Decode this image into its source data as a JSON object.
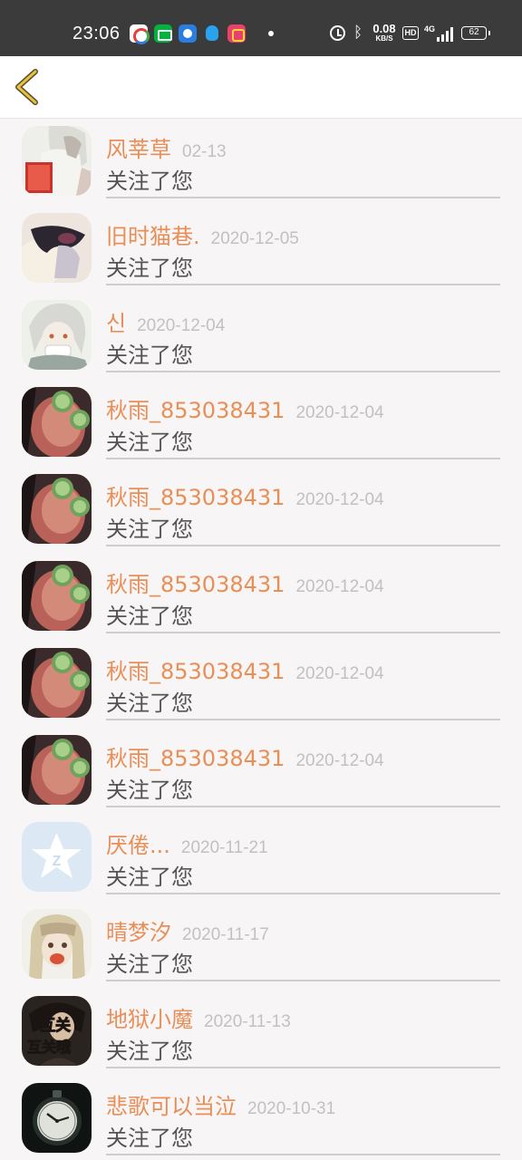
{
  "status_bar": {
    "time": "23:06",
    "net_speed_value": "0.08",
    "net_speed_unit": "KB/S",
    "hd_label": "HD",
    "signal_label": "4G",
    "battery_level": "62",
    "icons": [
      "chrome-like-app-icon",
      "iqiyi-icon",
      "browser-app-icon",
      "qq-icon",
      "kuaishou-icon",
      "alarm-icon",
      "bluetooth-icon"
    ]
  },
  "header": {
    "back_icon": "chevron-left-icon"
  },
  "colors": {
    "name": "#e98e57",
    "date": "#c2c0c1",
    "text": "#545454",
    "back_icon": "#e0b937"
  },
  "follow_list": [
    {
      "name": "风莘草",
      "date": "02-13",
      "action": "关注了您",
      "avatar": "anime-reading"
    },
    {
      "name": "旧时猫巷.",
      "date": "2020-12-05",
      "action": "关注了您",
      "avatar": "anime-blur"
    },
    {
      "name": "신",
      "date": "2020-12-04",
      "action": "关注了您",
      "avatar": "anime-silver"
    },
    {
      "name": "秋雨_853038431",
      "date": "2020-12-04",
      "action": "关注了您",
      "avatar": "photo-face"
    },
    {
      "name": "秋雨_853038431",
      "date": "2020-12-04",
      "action": "关注了您",
      "avatar": "photo-face"
    },
    {
      "name": "秋雨_853038431",
      "date": "2020-12-04",
      "action": "关注了您",
      "avatar": "photo-face"
    },
    {
      "name": "秋雨_853038431",
      "date": "2020-12-04",
      "action": "关注了您",
      "avatar": "photo-face"
    },
    {
      "name": "秋雨_853038431",
      "date": "2020-12-04",
      "action": "关注了您",
      "avatar": "photo-face"
    },
    {
      "name": "厌倦...",
      "date": "2020-11-21",
      "action": "关注了您",
      "avatar": "qzone-default"
    },
    {
      "name": "晴梦汐",
      "date": "2020-11-17",
      "action": "关注了您",
      "avatar": "anime-girl"
    },
    {
      "name": "地狱小魔",
      "date": "2020-11-13",
      "action": "关注了您",
      "avatar": "anime-dark",
      "avatar_text": "互关 互关哦"
    },
    {
      "name": "悲歌可以当泣",
      "date": "2020-10-31",
      "action": "关注了您",
      "avatar": "watch"
    }
  ]
}
